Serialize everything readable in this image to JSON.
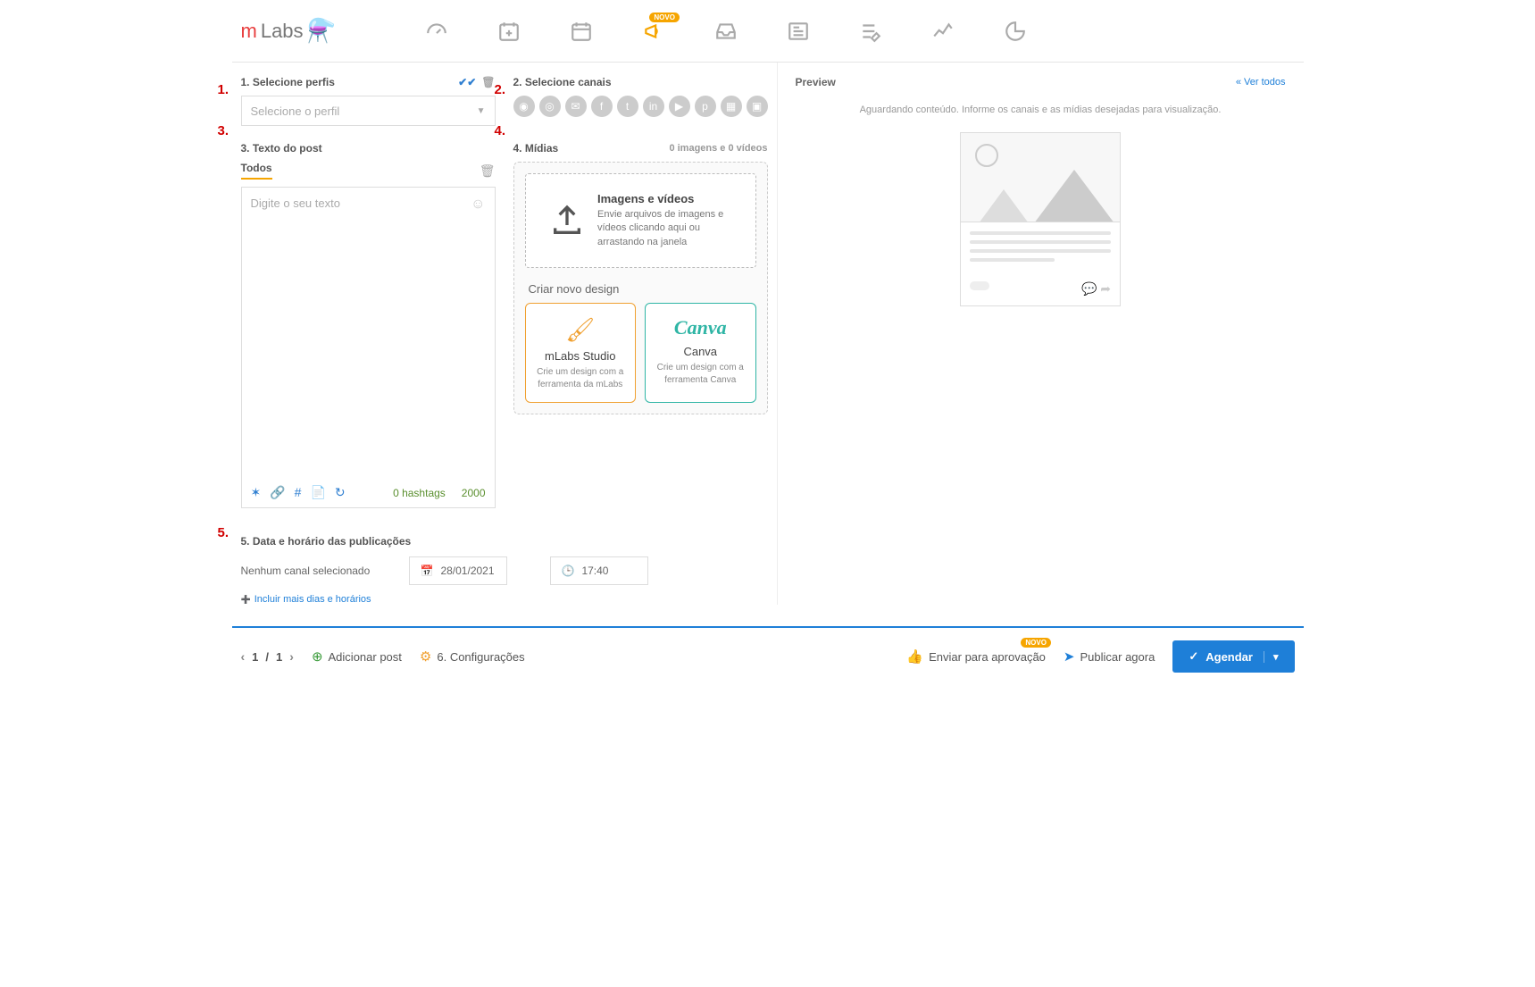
{
  "brand": {
    "m": "m",
    "labs": "Labs"
  },
  "nav_badge": "NOVO",
  "annotations": {
    "a1": "1.",
    "a2": "2.",
    "a3": "3.",
    "a4": "4.",
    "a5": "5."
  },
  "profiles": {
    "heading": "1. Selecione perfis",
    "placeholder": "Selecione o perfil"
  },
  "channels": {
    "heading": "2. Selecione canais"
  },
  "posttext": {
    "heading": "3. Texto do post",
    "tab_all": "Todos",
    "placeholder": "Digite o seu texto",
    "hashtags": "0 hashtags",
    "charlimit": "2000"
  },
  "media": {
    "heading": "4. Mídias",
    "counter": "0 imagens e 0 vídeos",
    "drop_title": "Imagens e vídeos",
    "drop_desc": "Envie arquivos de imagens e vídeos clicando aqui ou arrastando na janela",
    "design_heading": "Criar novo design",
    "studio": {
      "title": "mLabs Studio",
      "desc": "Crie um design com a ferramenta da mLabs"
    },
    "canva": {
      "brand": "Canva",
      "title": "Canva",
      "desc": "Crie um design com a ferramenta Canva"
    }
  },
  "schedule": {
    "heading": "5. Data e horário das publicações",
    "no_channel": "Nenhum canal selecionado",
    "date": "28/01/2021",
    "time": "17:40",
    "add_more": "Incluir mais dias e horários"
  },
  "preview": {
    "heading": "Preview",
    "see_all": "Ver todos",
    "waiting": "Aguardando conteúdo. Informe os canais e as mídias desejadas para visualização."
  },
  "footer": {
    "page_current": "1",
    "page_total": "1",
    "add_post": "Adicionar post",
    "config": "6. Configurações",
    "approval": "Enviar para aprovação",
    "approval_badge": "NOVO",
    "publish_now": "Publicar agora",
    "schedule_btn": "Agendar"
  }
}
